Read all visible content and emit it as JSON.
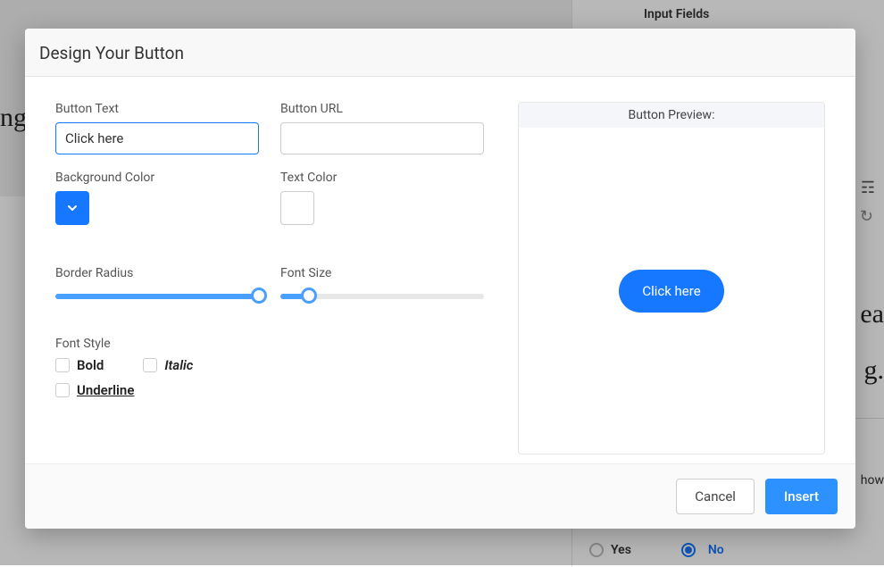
{
  "background": {
    "right_tab": "Input Fields",
    "left_text_fragment": "ng.",
    "right_serif_fragment1": "ea",
    "right_serif_fragment2": "g.",
    "show_fragment": "how",
    "radio": {
      "yes": "Yes",
      "no": "No"
    }
  },
  "modal": {
    "title": "Design Your Button",
    "fields": {
      "button_text": {
        "label": "Button Text",
        "value": "Click here"
      },
      "button_url": {
        "label": "Button URL",
        "value": ""
      },
      "background_color": {
        "label": "Background Color",
        "value": "#1677ff"
      },
      "text_color": {
        "label": "Text Color",
        "value": "#ffffff"
      },
      "border_radius": {
        "label": "Border Radius",
        "percent": 100
      },
      "font_size": {
        "label": "Font Size",
        "percent": 14
      },
      "font_style": {
        "label": "Font Style",
        "options": {
          "bold": "Bold",
          "italic": "Italic",
          "underline": "Underline"
        }
      }
    },
    "preview": {
      "header": "Button Preview:",
      "button_label": "Click here"
    },
    "actions": {
      "cancel": "Cancel",
      "insert": "Insert"
    }
  }
}
